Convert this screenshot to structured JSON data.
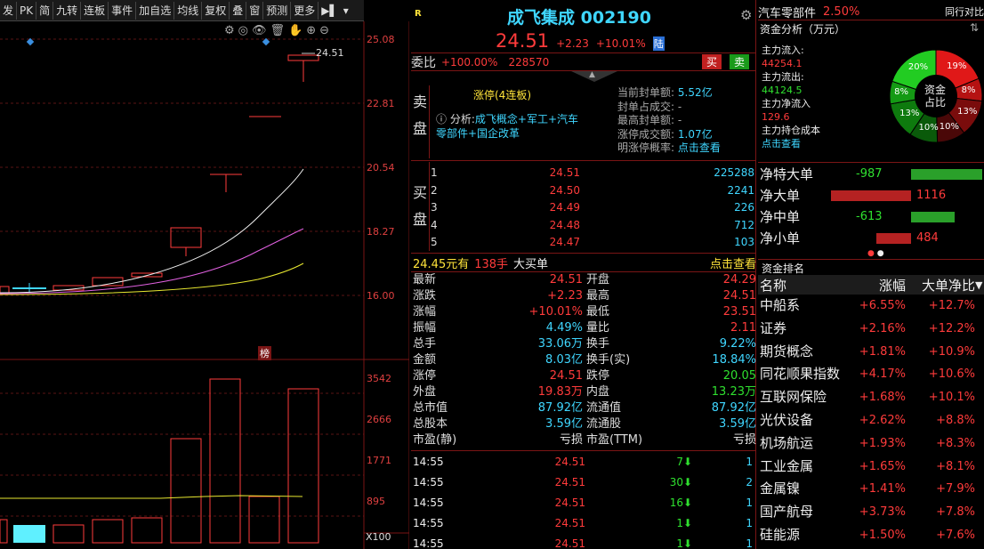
{
  "toolbar": {
    "items": [
      "发",
      "PK",
      "简",
      "九转",
      "连板",
      "事件",
      "加自选",
      "均线",
      "复权",
      "叠",
      "窗",
      "预测",
      "更多"
    ]
  },
  "chart": {
    "price_axis": [
      "25.08",
      "22.81",
      "20.54",
      "18.27",
      "16.00"
    ],
    "last_price_label": "24.51",
    "volume_axis": [
      "3542",
      "2666",
      "1771",
      "895"
    ],
    "volume_unit": "X100",
    "rank_badge": "榜"
  },
  "quote": {
    "badge": "R",
    "name": "成飞集成",
    "code": "002190",
    "price": "24.51",
    "change": "+2.23",
    "change_pct": "+10.01%",
    "exchange_badge": "陆",
    "weibi_label": "委比",
    "weibi_value": "+100.00%",
    "weibi_diff": "228570",
    "sell_btn": "买",
    "buy_btn": "卖"
  },
  "limit_info": {
    "status": "涨停(4连板)",
    "analysis_prefix": "分析:",
    "analysis_line1": "成飞概念+军工+汽车",
    "analysis_line2": "零部件+国企改革",
    "sell_side_label": [
      "卖",
      "盘"
    ],
    "fields": [
      {
        "label": "当前封单额:",
        "value": "5.52亿"
      },
      {
        "label": "封单占成交:",
        "value": "-"
      },
      {
        "label": "最高封单额:",
        "value": "-"
      },
      {
        "label": "涨停成交额:",
        "value": "1.07亿"
      },
      {
        "label": "明涨停概率:",
        "value": "点击查看"
      }
    ]
  },
  "buy_book": {
    "side_label": [
      "买",
      "盘"
    ],
    "rows": [
      {
        "level": "1",
        "price": "24.51",
        "vol": "225288"
      },
      {
        "level": "2",
        "price": "24.50",
        "vol": "2241"
      },
      {
        "level": "3",
        "price": "24.49",
        "vol": "226"
      },
      {
        "level": "4",
        "price": "24.48",
        "vol": "712"
      },
      {
        "level": "5",
        "price": "24.47",
        "vol": "103"
      }
    ]
  },
  "big_order": {
    "price": "24.45元有",
    "vol": "138手",
    "label": "大买单",
    "link": "点击查看"
  },
  "stats": [
    {
      "l1": "最新",
      "v1": "24.51",
      "c1": "red",
      "l2": "开盘",
      "v2": "24.29",
      "c2": "red"
    },
    {
      "l1": "涨跌",
      "v1": "+2.23",
      "c1": "red",
      "l2": "最高",
      "v2": "24.51",
      "c2": "red"
    },
    {
      "l1": "涨幅",
      "v1": "+10.01%",
      "c1": "red",
      "l2": "最低",
      "v2": "23.51",
      "c2": "red"
    },
    {
      "l1": "振幅",
      "v1": "4.49%",
      "c1": "cyan",
      "l2": "量比",
      "v2": "2.11",
      "c2": "red"
    },
    {
      "l1": "总手",
      "v1": "33.06万",
      "c1": "cyan",
      "l2": "换手",
      "v2": "9.22%",
      "c2": "cyan"
    },
    {
      "l1": "金额",
      "v1": "8.03亿",
      "c1": "cyan",
      "l2": "换手(实)",
      "v2": "18.84%",
      "c2": "cyan"
    },
    {
      "l1": "涨停",
      "v1": "24.51",
      "c1": "red",
      "l2": "跌停",
      "v2": "20.05",
      "c2": "green"
    },
    {
      "l1": "外盘",
      "v1": "19.83万",
      "c1": "red",
      "l2": "内盘",
      "v2": "13.23万",
      "c2": "green"
    },
    {
      "l1": "总市值",
      "v1": "87.92亿",
      "c1": "cyan",
      "l2": "流通值",
      "v2": "87.92亿",
      "c2": "cyan"
    },
    {
      "l1": "总股本",
      "v1": "3.59亿",
      "c1": "cyan",
      "l2": "流通股",
      "v2": "3.59亿",
      "c2": "cyan"
    },
    {
      "l1": "市盈(静)",
      "v1": "亏损",
      "c1": "white",
      "l2": "市盈(TTM)",
      "v2": "亏损",
      "c2": "white"
    }
  ],
  "ticks": [
    {
      "time": "14:55",
      "price": "24.51",
      "vol": "7",
      "num": "1"
    },
    {
      "time": "14:55",
      "price": "24.51",
      "vol": "30",
      "num": "2"
    },
    {
      "time": "14:55",
      "price": "24.51",
      "vol": "16",
      "num": "1"
    },
    {
      "time": "14:55",
      "price": "24.51",
      "vol": "1",
      "num": "1"
    },
    {
      "time": "14:55",
      "price": "24.51",
      "vol": "1",
      "num": "1"
    }
  ],
  "sector": {
    "name": "汽车零部件",
    "pct": "2.50%",
    "compare": "同行对比"
  },
  "fund": {
    "title": "资金分析（万元）",
    "in_label": "主力流入:",
    "in_value": "44254.1",
    "out_label": "主力流出:",
    "out_value": "44124.5",
    "net_label": "主力净流入",
    "net_value": "129.6",
    "cost_label": "主力持仓成本",
    "cost_link": "点击查看",
    "donut_center": [
      "资金",
      "占比"
    ],
    "donut_pcts": [
      "19%",
      "8%",
      "13%",
      "10%",
      "10%",
      "13%",
      "8%",
      "20%"
    ]
  },
  "net_flow": [
    {
      "label": "净特大单",
      "value": "-987"
    },
    {
      "label": "净大单",
      "value": "1116"
    },
    {
      "label": "净中单",
      "value": "-613"
    },
    {
      "label": "净小单",
      "value": "484"
    }
  ],
  "ranking": {
    "title": "资金排名",
    "headers": [
      "名称",
      "涨幅",
      "大单净比"
    ],
    "rows": [
      {
        "name": "中船系",
        "pct": "+6.55%",
        "ratio": "+12.7%"
      },
      {
        "name": "证券",
        "pct": "+2.16%",
        "ratio": "+12.2%"
      },
      {
        "name": "期货概念",
        "pct": "+1.81%",
        "ratio": "+10.9%"
      },
      {
        "name": "同花顺果指数",
        "pct": "+4.17%",
        "ratio": "+10.6%"
      },
      {
        "name": "互联网保险",
        "pct": "+1.68%",
        "ratio": "+10.1%"
      },
      {
        "name": "光伏设备",
        "pct": "+2.62%",
        "ratio": "+8.8%"
      },
      {
        "name": "机场航运",
        "pct": "+1.93%",
        "ratio": "+8.3%"
      },
      {
        "name": "工业金属",
        "pct": "+1.65%",
        "ratio": "+8.1%"
      },
      {
        "name": "金属镍",
        "pct": "+1.41%",
        "ratio": "+7.9%"
      },
      {
        "name": "国产航母",
        "pct": "+3.73%",
        "ratio": "+7.8%"
      },
      {
        "name": "硅能源",
        "pct": "+1.50%",
        "ratio": "+7.6%"
      }
    ]
  },
  "colors": {
    "up": "#ff3b3b",
    "down": "#2fe02f",
    "cyan": "#3fd6ff",
    "bg": "#000000"
  }
}
